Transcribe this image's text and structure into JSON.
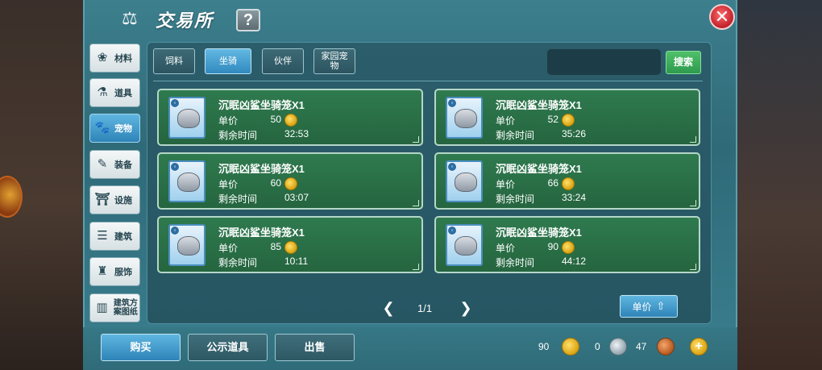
{
  "window": {
    "title": "交易所",
    "help_label": "?",
    "close_label": "✕"
  },
  "nav": [
    {
      "label": "材料",
      "icon": "materials-icon",
      "glyph": "❀"
    },
    {
      "label": "道具",
      "icon": "flask-icon",
      "glyph": "⚗"
    },
    {
      "label": "宠物",
      "icon": "paw-icon",
      "glyph": "🐾",
      "active": true
    },
    {
      "label": "装备",
      "icon": "armor-icon",
      "glyph": "✎"
    },
    {
      "label": "设施",
      "icon": "facility-icon",
      "glyph": "⛩"
    },
    {
      "label": "建筑",
      "icon": "building-icon",
      "glyph": "☰"
    },
    {
      "label": "服饰",
      "icon": "clothing-icon",
      "glyph": "♜"
    },
    {
      "label": "建筑方案图纸",
      "icon": "blueprint-icon",
      "glyph": "▥"
    }
  ],
  "subtabs": [
    {
      "label": "饲料"
    },
    {
      "label": "坐骑",
      "active": true
    },
    {
      "label": "伙伴"
    },
    {
      "label": "家园宠物"
    }
  ],
  "search": {
    "placeholder": "",
    "button_label": "搜索"
  },
  "listings": [
    {
      "name": "沉眠凶鲨坐骑笼X1",
      "price_label": "单价",
      "price": "50",
      "time_label": "剩余时间",
      "time": "32:53"
    },
    {
      "name": "沉眠凶鲨坐骑笼X1",
      "price_label": "单价",
      "price": "52",
      "time_label": "剩余时间",
      "time": "35:26"
    },
    {
      "name": "沉眠凶鲨坐骑笼X1",
      "price_label": "单价",
      "price": "60",
      "time_label": "剩余时间",
      "time": "03:07"
    },
    {
      "name": "沉眠凶鲨坐骑笼X1",
      "price_label": "单价",
      "price": "66",
      "time_label": "剩余时间",
      "time": "33:24"
    },
    {
      "name": "沉眠凶鲨坐骑笼X1",
      "price_label": "单价",
      "price": "85",
      "time_label": "剩余时间",
      "time": "10:11"
    },
    {
      "name": "沉眠凶鲨坐骑笼X1",
      "price_label": "单价",
      "price": "90",
      "time_label": "剩余时间",
      "time": "44:12"
    }
  ],
  "pager": {
    "text": "1/1",
    "prev": "❮",
    "next": "❯"
  },
  "sort": {
    "label": "单价",
    "arrow": "⇧"
  },
  "bottom": {
    "buy": "购买",
    "public_items": "公示道具",
    "sell": "出售"
  },
  "currency": {
    "gold": "90",
    "silver": "0",
    "bronze": "47",
    "plus": "+"
  }
}
